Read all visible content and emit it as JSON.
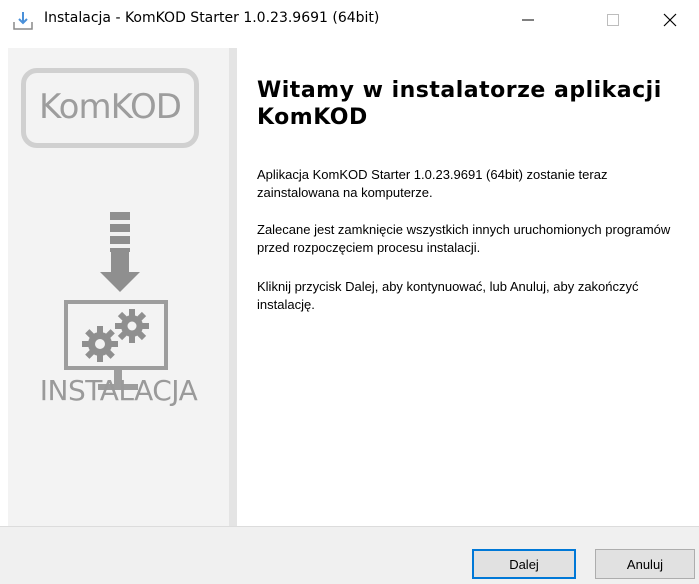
{
  "window": {
    "title": "Instalacja - KomKOD Starter 1.0.23.9691 (64bit)",
    "controls": [
      "minimize-icon",
      "maximize-icon",
      "close-icon"
    ]
  },
  "sidebar": {
    "logo_text": "KomKOD",
    "install_label": "INSTALACJA",
    "icons": [
      "download-arrow-icon",
      "monitor-gears-icon"
    ]
  },
  "main": {
    "heading": "Witamy w instalatorze aplikacji KomKOD",
    "paragraphs": [
      "Aplikacja KomKOD Starter 1.0.23.9691 (64bit) zostanie teraz zainstalowana na komputerze.",
      "Zalecane jest zamknięcie wszystkich innych uruchomionych programów przed rozpoczęciem procesu instalacji.",
      "Kliknij przycisk Dalej, aby kontynuować, lub Anuluj, aby zakończyć instalację."
    ]
  },
  "buttons": {
    "next": "Dalej",
    "cancel": "Anuluj"
  },
  "colors": {
    "focus_border": "#0078d7",
    "sidebar_bg": "#f3f3f3",
    "graphic_gray": "#9d9d9d"
  }
}
